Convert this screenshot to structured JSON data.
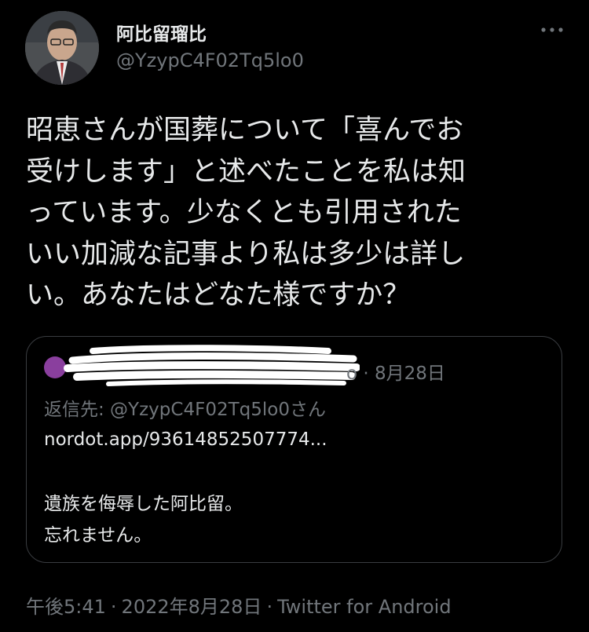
{
  "author": {
    "display_name": "阿比留瑠比",
    "handle": "@YzypC4F02Tq5lo0"
  },
  "more_icon": "more-horizontal-icon",
  "tweet": {
    "text": "昭恵さんが国葬について「喜んでお\n受けします」と述べたことを私は知\nっています。少なくとも引用された\nいい加減な記事より私は多少は詳し\nい。あなたはどなた様ですか？"
  },
  "quoted": {
    "name_suffix": "o",
    "date": "8月28日",
    "date_separator": "·",
    "reply_to": "返信先: @YzypC4F02Tq5lo0さん",
    "link": "nordot.app/93614852507774...",
    "line1": "遺族を侮辱した阿比留。",
    "line2": "忘れません。",
    "avatar_color": "#8a3f9e"
  },
  "meta": {
    "time": "午後5:41",
    "date": "2022年8月28日",
    "separator": "·",
    "client": "Twitter for Android"
  },
  "colors": {
    "background": "#000000",
    "text": "#e7e9ea",
    "muted": "#71767b",
    "border": "#3a3d41"
  }
}
